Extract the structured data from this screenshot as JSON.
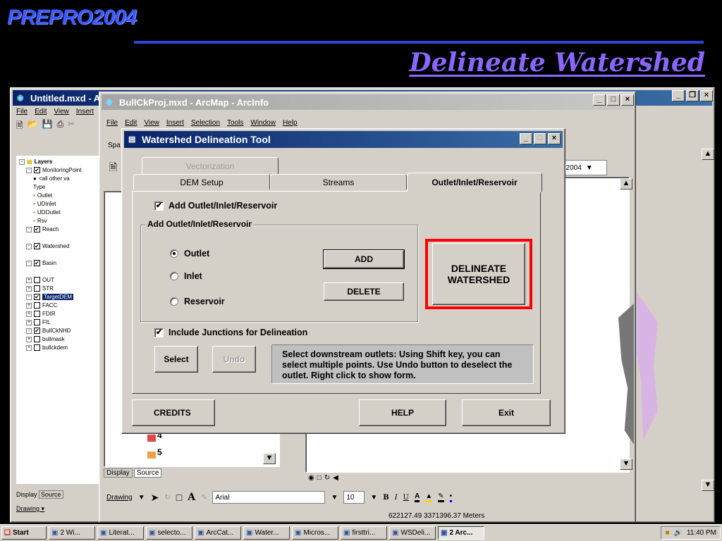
{
  "slide": {
    "brand": "PREPRO2004",
    "title": "Delineate Watershed"
  },
  "bg_window": {
    "title": "Untitled.mxd - Arc",
    "menus": [
      "File",
      "Edit",
      "View",
      "Insert",
      "S"
    ],
    "toc": {
      "root": "Layers",
      "items": [
        {
          "label": "MonitoringPoint",
          "indent": 1,
          "box": "check"
        },
        {
          "label": "<all other va",
          "indent": 2,
          "box": "none",
          "sym": "●"
        },
        {
          "label": "Type",
          "indent": 2,
          "box": "none"
        },
        {
          "label": "Outlet",
          "indent": 2,
          "box": "none",
          "sym": "•"
        },
        {
          "label": "UDInlet",
          "indent": 2,
          "box": "none",
          "sym": "•"
        },
        {
          "label": "UDOutlet",
          "indent": 2,
          "box": "none",
          "sym": "•"
        },
        {
          "label": "Rsv",
          "indent": 2,
          "box": "none",
          "sym": "•"
        },
        {
          "label": "Reach",
          "indent": 1,
          "box": "check"
        },
        {
          "label": "Watershed",
          "indent": 1,
          "box": "check"
        },
        {
          "label": "Basin",
          "indent": 1,
          "box": "check"
        },
        {
          "label": "OUT",
          "indent": 1,
          "box": "empty"
        },
        {
          "label": "STR",
          "indent": 1,
          "box": "empty"
        },
        {
          "label": "TargetDEM",
          "indent": 1,
          "box": "check",
          "selected": true
        },
        {
          "label": "FACC",
          "indent": 1,
          "box": "empty"
        },
        {
          "label": "FDIR",
          "indent": 1,
          "box": "empty"
        },
        {
          "label": "FIL",
          "indent": 1,
          "box": "empty"
        },
        {
          "label": "BullCkNHD",
          "indent": 1,
          "box": "check"
        },
        {
          "label": "bullmask",
          "indent": 1,
          "box": "empty"
        },
        {
          "label": "bullckdem",
          "indent": 1,
          "box": "empty"
        }
      ]
    },
    "display_tab": "Display",
    "source_tab": "Source",
    "drawing": "Drawing ▾"
  },
  "mid_window": {
    "title": "BullCkProj.mxd - ArcMap - ArcInfo",
    "menus": [
      "File",
      "Edit",
      "View",
      "Insert",
      "Selection",
      "Tools",
      "Window",
      "Help"
    ],
    "toolbar_label": "Spa",
    "combo_value": "o2004",
    "legend_items": [
      "4",
      "5"
    ],
    "display_tab": "Display",
    "source_tab": "Source",
    "drawing": "Drawing",
    "font_name": "Arial",
    "font_size": "10",
    "format": [
      "B",
      "I",
      "U"
    ],
    "coords": "622127.49  3371396.37 Meters"
  },
  "dialog": {
    "title": "Watershed Delineation Tool",
    "tabs": {
      "vectorization": "Vectorization",
      "dem_setup": "DEM Setup",
      "streams": "Streams",
      "outlet": "Outlet/Inlet/Reservoir"
    },
    "add_outlet_check": "Add Outlet/Inlet/Reservoir",
    "group_label": "Add Outlet/Inlet/Reservoir",
    "radios": {
      "outlet": "Outlet",
      "inlet": "Inlet",
      "reservoir": "Reservoir"
    },
    "add_button": "ADD",
    "delete_button": "DELETE",
    "delineate_button": {
      "line1": "DELINEATE",
      "line2": "WATERSHED"
    },
    "junctions_check": "Include Junctions for Delineation",
    "select_button": "Select",
    "undo_button": "Undo",
    "help_text": "Select downstream outlets: Using Shift key, you can select multiple points. Use Undo button to deselect the outlet. Right click to show form.",
    "credits_button": "CREDITS",
    "help_button": "HELP",
    "exit_button": "Exit"
  },
  "taskbar": {
    "start": "Start",
    "tasks": [
      "2 Wi...",
      "Literat...",
      "selecto...",
      "ArcCat...",
      "Water...",
      "Micros...",
      "firsttri...",
      "WSDeli...",
      "2 Arc..."
    ],
    "active_index": 8,
    "clock": "11:40 PM"
  },
  "colors": {
    "brand": "#3c5aff",
    "title": "#8a66ff",
    "highlight": "#ff0000",
    "titlebar": "#0a246a"
  }
}
